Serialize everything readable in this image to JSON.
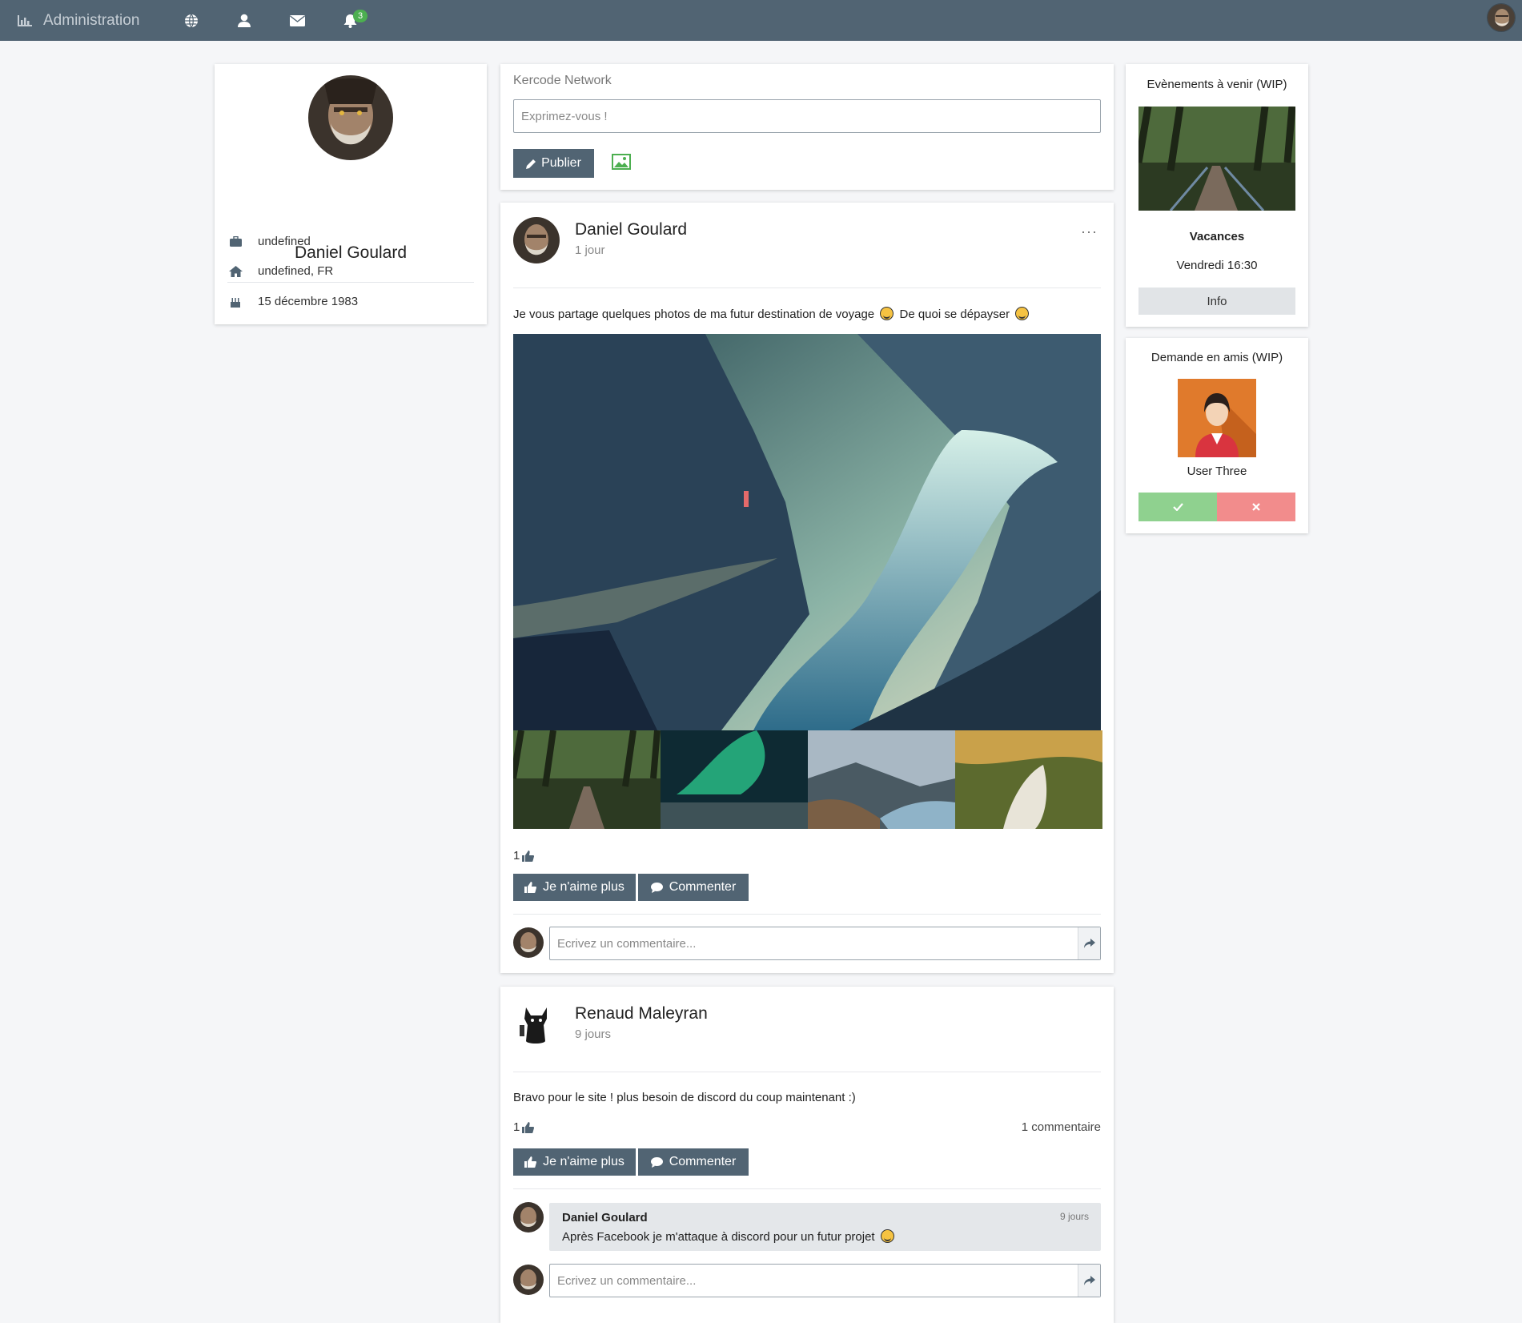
{
  "nav": {
    "brand_label": "Administration",
    "brand_icon": "bar-chart-icon",
    "icons": [
      "globe-icon",
      "user-icon",
      "envelope-icon",
      "bell-icon"
    ],
    "notification_count": "3"
  },
  "profile": {
    "name": "Daniel Goulard",
    "job": "undefined",
    "location": "undefined, FR",
    "birthday": "15 décembre 1983"
  },
  "composer": {
    "title": "Kercode Network",
    "placeholder": "Exprimez-vous !",
    "publish_label": "Publier"
  },
  "posts": [
    {
      "author": "Daniel Goulard",
      "time": "1 jour",
      "text_part1": "Je vous partage quelques photos de ma futur destination de voyage",
      "text_part2": "De quoi se dépayser",
      "likes": "1",
      "like_label": "Je n'aime plus",
      "comment_label": "Commenter",
      "comment_placeholder": "Ecrivez un commentaire..."
    },
    {
      "author": "Renaud Maleyran",
      "time": "9 jours",
      "text": "Bravo pour le site ! plus besoin de discord du coup maintenant :)",
      "likes": "1",
      "comments_count": "1 commentaire",
      "like_label": "Je n'aime plus",
      "comment_label": "Commenter",
      "comments": [
        {
          "author": "Daniel Goulard",
          "time": "9 jours",
          "text": "Après Facebook je m'attaque à discord pour un futur projet"
        }
      ],
      "comment_placeholder": "Ecrivez un commentaire..."
    }
  ],
  "events": {
    "title": "Evènements à venir (WIP)",
    "name": "Vacances",
    "date": "Vendredi 16:30",
    "info_label": "Info"
  },
  "friend_requests": {
    "title": "Demande en amis (WIP)",
    "name": "User Three"
  },
  "colors": {
    "navbar": "#516473",
    "button": "#516473",
    "accept": "#8fd18f",
    "reject": "#f28c8c",
    "badge": "#4caf50"
  }
}
